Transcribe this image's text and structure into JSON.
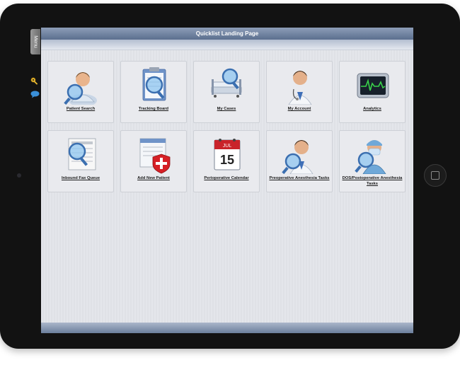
{
  "window": {
    "title": "Quicklist Landing Page"
  },
  "menu": {
    "label": "Menu"
  },
  "icons": {
    "side": [
      "key-icon",
      "chat-icon"
    ]
  },
  "tiles": [
    {
      "label": "Patient Search",
      "icon": "patient-search-icon"
    },
    {
      "label": "Tracking Board",
      "icon": "tracking-board-icon"
    },
    {
      "label": "My Cases",
      "icon": "my-cases-icon"
    },
    {
      "label": "My Account",
      "icon": "my-account-icon"
    },
    {
      "label": "Analytics",
      "icon": "analytics-icon"
    },
    {
      "label": "Inbound Fax Queue",
      "icon": "inbound-fax-icon"
    },
    {
      "label": "Add New Patient",
      "icon": "add-new-patient-icon"
    },
    {
      "label": "Perioperative Calendar",
      "icon": "calendar-icon",
      "calendar": {
        "month": "JUL",
        "day": "15"
      }
    },
    {
      "label": "Preoperative Anesthesia Tasks",
      "icon": "preop-anesthesia-icon"
    },
    {
      "label": "DOS/Postoperative Anesthesia Tasks",
      "icon": "postop-anesthesia-icon"
    }
  ],
  "colors": {
    "titlebar": "#5b6f8e",
    "accent_key": "#e8b830",
    "accent_chat": "#3a8fd8",
    "analytics_wave": "#39d24a",
    "cross_red": "#d62026"
  }
}
